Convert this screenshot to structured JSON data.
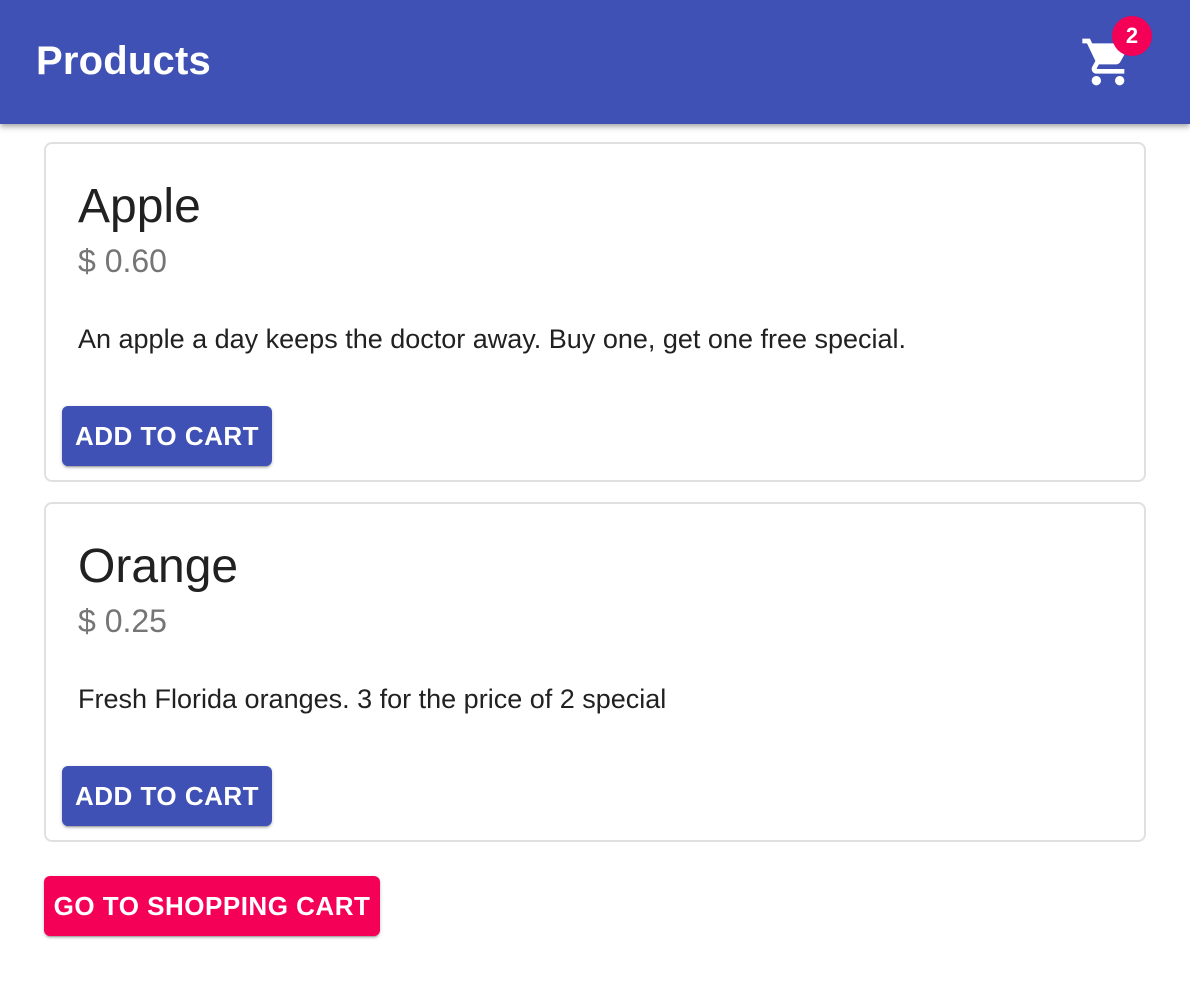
{
  "appbar": {
    "title": "Products",
    "cart_icon": "shopping-cart-icon",
    "cart_count": "2",
    "color": "#3f51b5",
    "badge_color": "#f50057"
  },
  "products": [
    {
      "name": "Apple",
      "price": "$ 0.60",
      "description": "An apple a day keeps the doctor away. Buy one, get one free special.",
      "button_label": "ADD TO CART"
    },
    {
      "name": "Orange",
      "price": "$ 0.25",
      "description": "Fresh Florida oranges. 3 for the price of 2 special",
      "button_label": "ADD TO CART"
    }
  ],
  "go_to_cart_label": "GO TO SHOPPING CART",
  "colors": {
    "primary": "#3f51b5",
    "secondary": "#f50057"
  }
}
